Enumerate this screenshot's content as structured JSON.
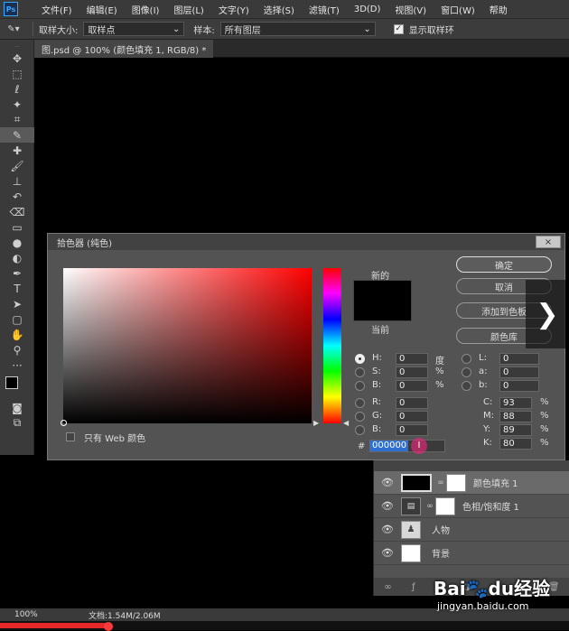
{
  "menubar": {
    "logo": "Ps",
    "items": [
      "文件(F)",
      "编辑(E)",
      "图像(I)",
      "图层(L)",
      "文字(Y)",
      "选择(S)",
      "滤镜(T)",
      "3D(D)",
      "视图(V)",
      "窗口(W)",
      "帮助"
    ]
  },
  "options": {
    "sample_size_label": "取样大小:",
    "sample_size_value": "取样点",
    "sample_label": "样本:",
    "sample_value": "所有图层",
    "show_ring_label": "显示取样环",
    "show_ring_checked": true
  },
  "document": {
    "tab_title": "图.psd @ 100% (颜色填充 1, RGB/8) *"
  },
  "color_picker": {
    "title": "拾色器 (纯色)",
    "close": "×",
    "new_label": "新的",
    "current_label": "当前",
    "swatch_color": "#000000",
    "buttons": {
      "ok": "确定",
      "cancel": "取消",
      "add_to_swatches": "添加到色板",
      "color_libraries": "颜色库"
    },
    "web_only_label": "只有 Web 颜色",
    "hsb": {
      "h_label": "H:",
      "h_value": "0",
      "h_unit": "度",
      "s_label": "S:",
      "s_value": "0",
      "s_unit": "%",
      "b_label": "B:",
      "b_value": "0",
      "b_unit": "%"
    },
    "rgb": {
      "r_label": "R:",
      "r_value": "0",
      "g_label": "G:",
      "g_value": "0",
      "b_label": "B:",
      "b_value": "0"
    },
    "lab": {
      "l_label": "L:",
      "l_value": "0",
      "a_label": "a:",
      "a_value": "0",
      "b_label": "b:",
      "b_value": "0"
    },
    "cmyk": {
      "c_label": "C:",
      "c_value": "93",
      "c_unit": "%",
      "m_label": "M:",
      "m_value": "88",
      "m_unit": "%",
      "y_label": "Y:",
      "y_value": "89",
      "y_unit": "%",
      "k_label": "K:",
      "k_value": "80",
      "k_unit": "%"
    },
    "hex_label": "#",
    "hex_value": "000000"
  },
  "layers": {
    "rows": [
      {
        "name": "颜色填充 1",
        "selected": true
      },
      {
        "name": "色相/饱和度 1",
        "selected": false
      },
      {
        "name": "人物",
        "selected": false
      },
      {
        "name": "背景",
        "selected": false
      }
    ]
  },
  "status": {
    "zoom": "100%",
    "doc_info": "文档:1.54M/2.06M"
  },
  "video_progress": 0.19,
  "watermark": {
    "logo_a": "Bai",
    "logo_b": "du",
    "logo_c": "经验",
    "url": "jingyan.baidu.com"
  }
}
